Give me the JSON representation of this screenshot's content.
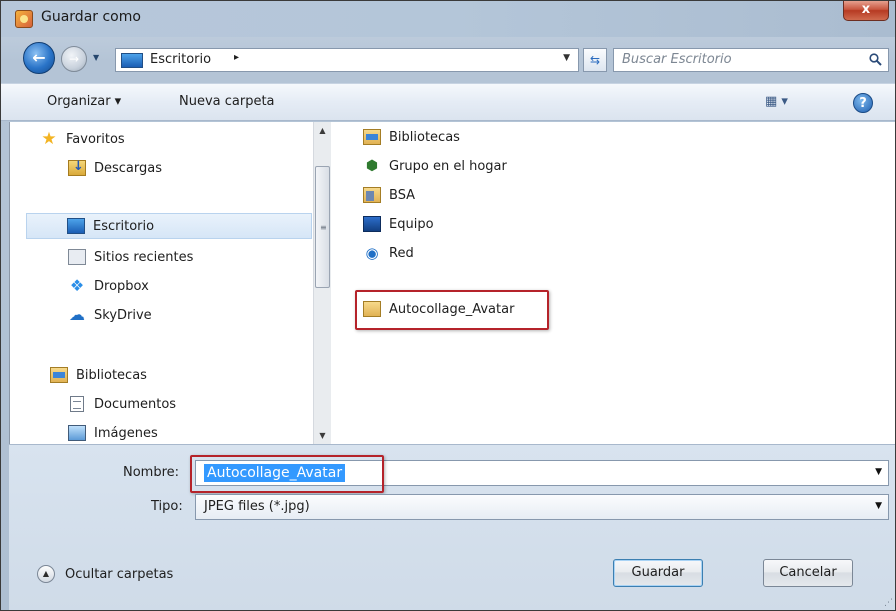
{
  "window": {
    "title": "Guardar como",
    "close_glyph": "x"
  },
  "address": {
    "location": "Escritorio",
    "separator": "▸",
    "search_placeholder": "Buscar Escritorio"
  },
  "toolbar": {
    "organize_label": "Organizar ▾",
    "new_folder_label": "Nueva carpeta",
    "views_glyph": "▦ ▾",
    "help_glyph": "?"
  },
  "sidebar": {
    "favorites_header": "Favoritos",
    "favorites": [
      {
        "label": "Descargas",
        "icon": "downloads-icon"
      },
      {
        "label": "Escritorio",
        "icon": "desktop-icon",
        "selected": true
      },
      {
        "label": "Sitios recientes",
        "icon": "recent-places-icon"
      },
      {
        "label": "Dropbox",
        "icon": "dropbox-icon"
      },
      {
        "label": "SkyDrive",
        "icon": "skydrive-icon"
      }
    ],
    "libraries_header": "Bibliotecas",
    "libraries": [
      {
        "label": "Documentos",
        "icon": "documents-icon"
      },
      {
        "label": "Imágenes",
        "icon": "images-icon"
      }
    ]
  },
  "files": [
    {
      "label": "Bibliotecas",
      "icon": "libraries-icon"
    },
    {
      "label": "Grupo en el hogar",
      "icon": "homegroup-icon"
    },
    {
      "label": "BSA",
      "icon": "user-folder-icon"
    },
    {
      "label": "Equipo",
      "icon": "computer-icon"
    },
    {
      "label": "Red",
      "icon": "network-icon"
    },
    {
      "label": "Autocollage_Avatar",
      "icon": "folder-icon",
      "highlighted": true
    }
  ],
  "form": {
    "name_label": "Nombre:",
    "name_value": "Autocollage_Avatar",
    "type_label": "Tipo:",
    "type_value": "JPEG files (*.jpg)",
    "hide_folders_label": "Ocultar carpetas",
    "save_label": "Guardar",
    "cancel_label": "Cancelar"
  },
  "colors": {
    "highlight": "#b5232a",
    "selection": "#3399ff"
  }
}
